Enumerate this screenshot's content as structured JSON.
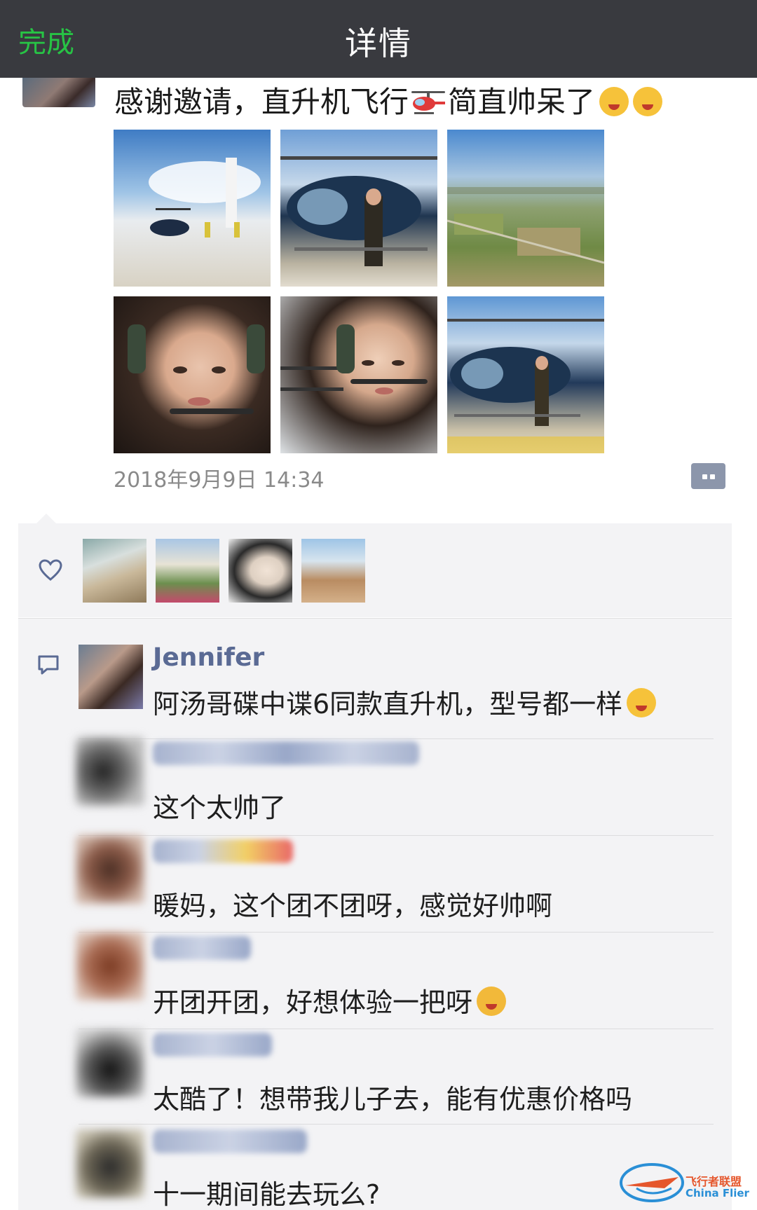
{
  "nav": {
    "done_label": "完成",
    "title": "详情"
  },
  "post": {
    "text_part1": "感谢邀请，直升机飞行",
    "text_part2": "简直帅呆了",
    "emoji_names": [
      "helicopter-icon",
      "winking-tongue-emoji",
      "winking-tongue-emoji"
    ],
    "photo_count": 6,
    "timestamp": "2018年9月9日 14:34"
  },
  "likes": {
    "icon": "heart-icon",
    "avatar_count": 4
  },
  "comments": [
    {
      "name": "Jennifer",
      "text": "阿汤哥碟中谍6同款直升机，型号都一样",
      "emoji": "grinning-emoji"
    },
    {
      "name": "",
      "text": "这个太帅了"
    },
    {
      "name": "",
      "text": "暖妈，这个团不团呀，感觉好帅啊"
    },
    {
      "name": "",
      "text": "开团开团，好想体验一把呀",
      "emoji": "thinking-emoji"
    },
    {
      "name": "",
      "text": "太酷了！想带我儿子去，能有优惠价格吗"
    },
    {
      "name": "",
      "text": "十一期间能去玩么?"
    }
  ],
  "watermark": {
    "cn": "飞行者联盟",
    "en": "China Flier"
  },
  "colors": {
    "navbar": "#393a3f",
    "done_green": "#27c345",
    "name_blue": "#5a6a94",
    "panel_bg": "#f3f3f5"
  }
}
